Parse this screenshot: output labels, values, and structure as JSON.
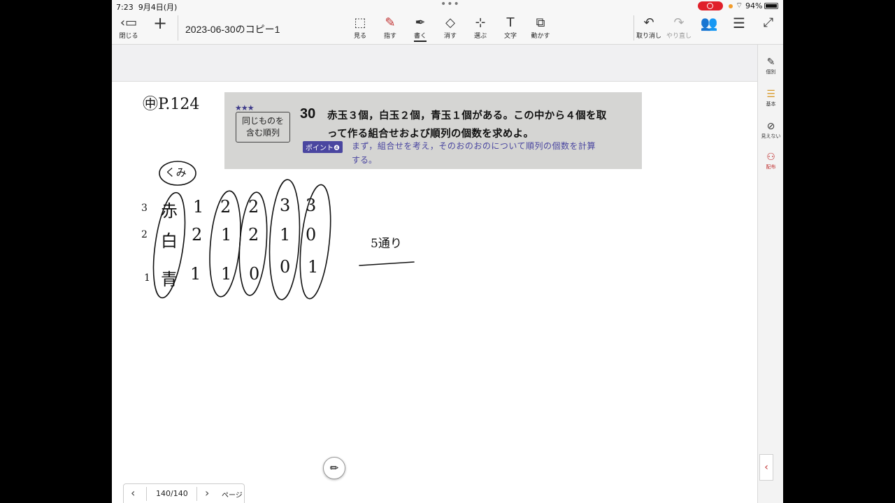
{
  "status_bar": {
    "time": "7:23",
    "date": "9月4日(月)",
    "battery": "94%",
    "multitask_icon": "ellipsis-icon",
    "recording_color": "#e0202a"
  },
  "toolbar": {
    "close_label": "閉じる",
    "add_icon": "plus-icon",
    "document_title": "2023-06-30のコピー1",
    "tools": [
      {
        "label": "見る",
        "icon": "view-icon"
      },
      {
        "label": "指す",
        "icon": "laser-pointer-icon"
      },
      {
        "label": "書く",
        "icon": "pen-icon"
      },
      {
        "label": "消す",
        "icon": "eraser-icon"
      },
      {
        "label": "選ぶ",
        "icon": "lasso-icon"
      },
      {
        "label": "文字",
        "icon": "text-icon"
      },
      {
        "label": "動かす",
        "icon": "move-icon"
      }
    ],
    "undo_label": "取り消し",
    "redo_label": "やり直し",
    "users_icon": "users-icon",
    "menu_icon": "hamburger-icon",
    "expand_icon": "expand-icon"
  },
  "sidebar": {
    "items": [
      {
        "label": "個別",
        "icon": "edit-note-icon"
      },
      {
        "label": "基本",
        "icon": "layers-icon"
      },
      {
        "label": "見えない",
        "icon": "hidden-icon"
      },
      {
        "label": "配布",
        "icon": "distribute-icon"
      }
    ],
    "accent": "#c03030"
  },
  "problem": {
    "stars": "★★★",
    "tag_line1": "同じものを",
    "tag_line2": "含む順列",
    "number": "30",
    "line1": "赤玉３個，白玉２個，青玉１個がある。この中から４個を取",
    "line2": "って作る組合せおよび順列の個数を求めよ。",
    "point_label": "ポイント❹",
    "hint_line1": "まず，組合せを考え，そのおのおのについて順列の個数を計算",
    "hint_line2": "する。",
    "accent": "#4a46a0"
  },
  "handwriting": {
    "ref": "㊥P.124",
    "group_label": "くみ",
    "counts": [
      "3",
      "2",
      "1"
    ],
    "colors": [
      "赤",
      "白",
      "青"
    ],
    "combinations": [
      [
        "1",
        "2",
        "1"
      ],
      [
        "2",
        "1",
        "1"
      ],
      [
        "2",
        "2",
        "0"
      ],
      [
        "3",
        "1",
        "0"
      ],
      [
        "3",
        "0",
        "1"
      ]
    ],
    "result": "5通り"
  },
  "pager": {
    "page": "140/140",
    "label": "ページ"
  }
}
